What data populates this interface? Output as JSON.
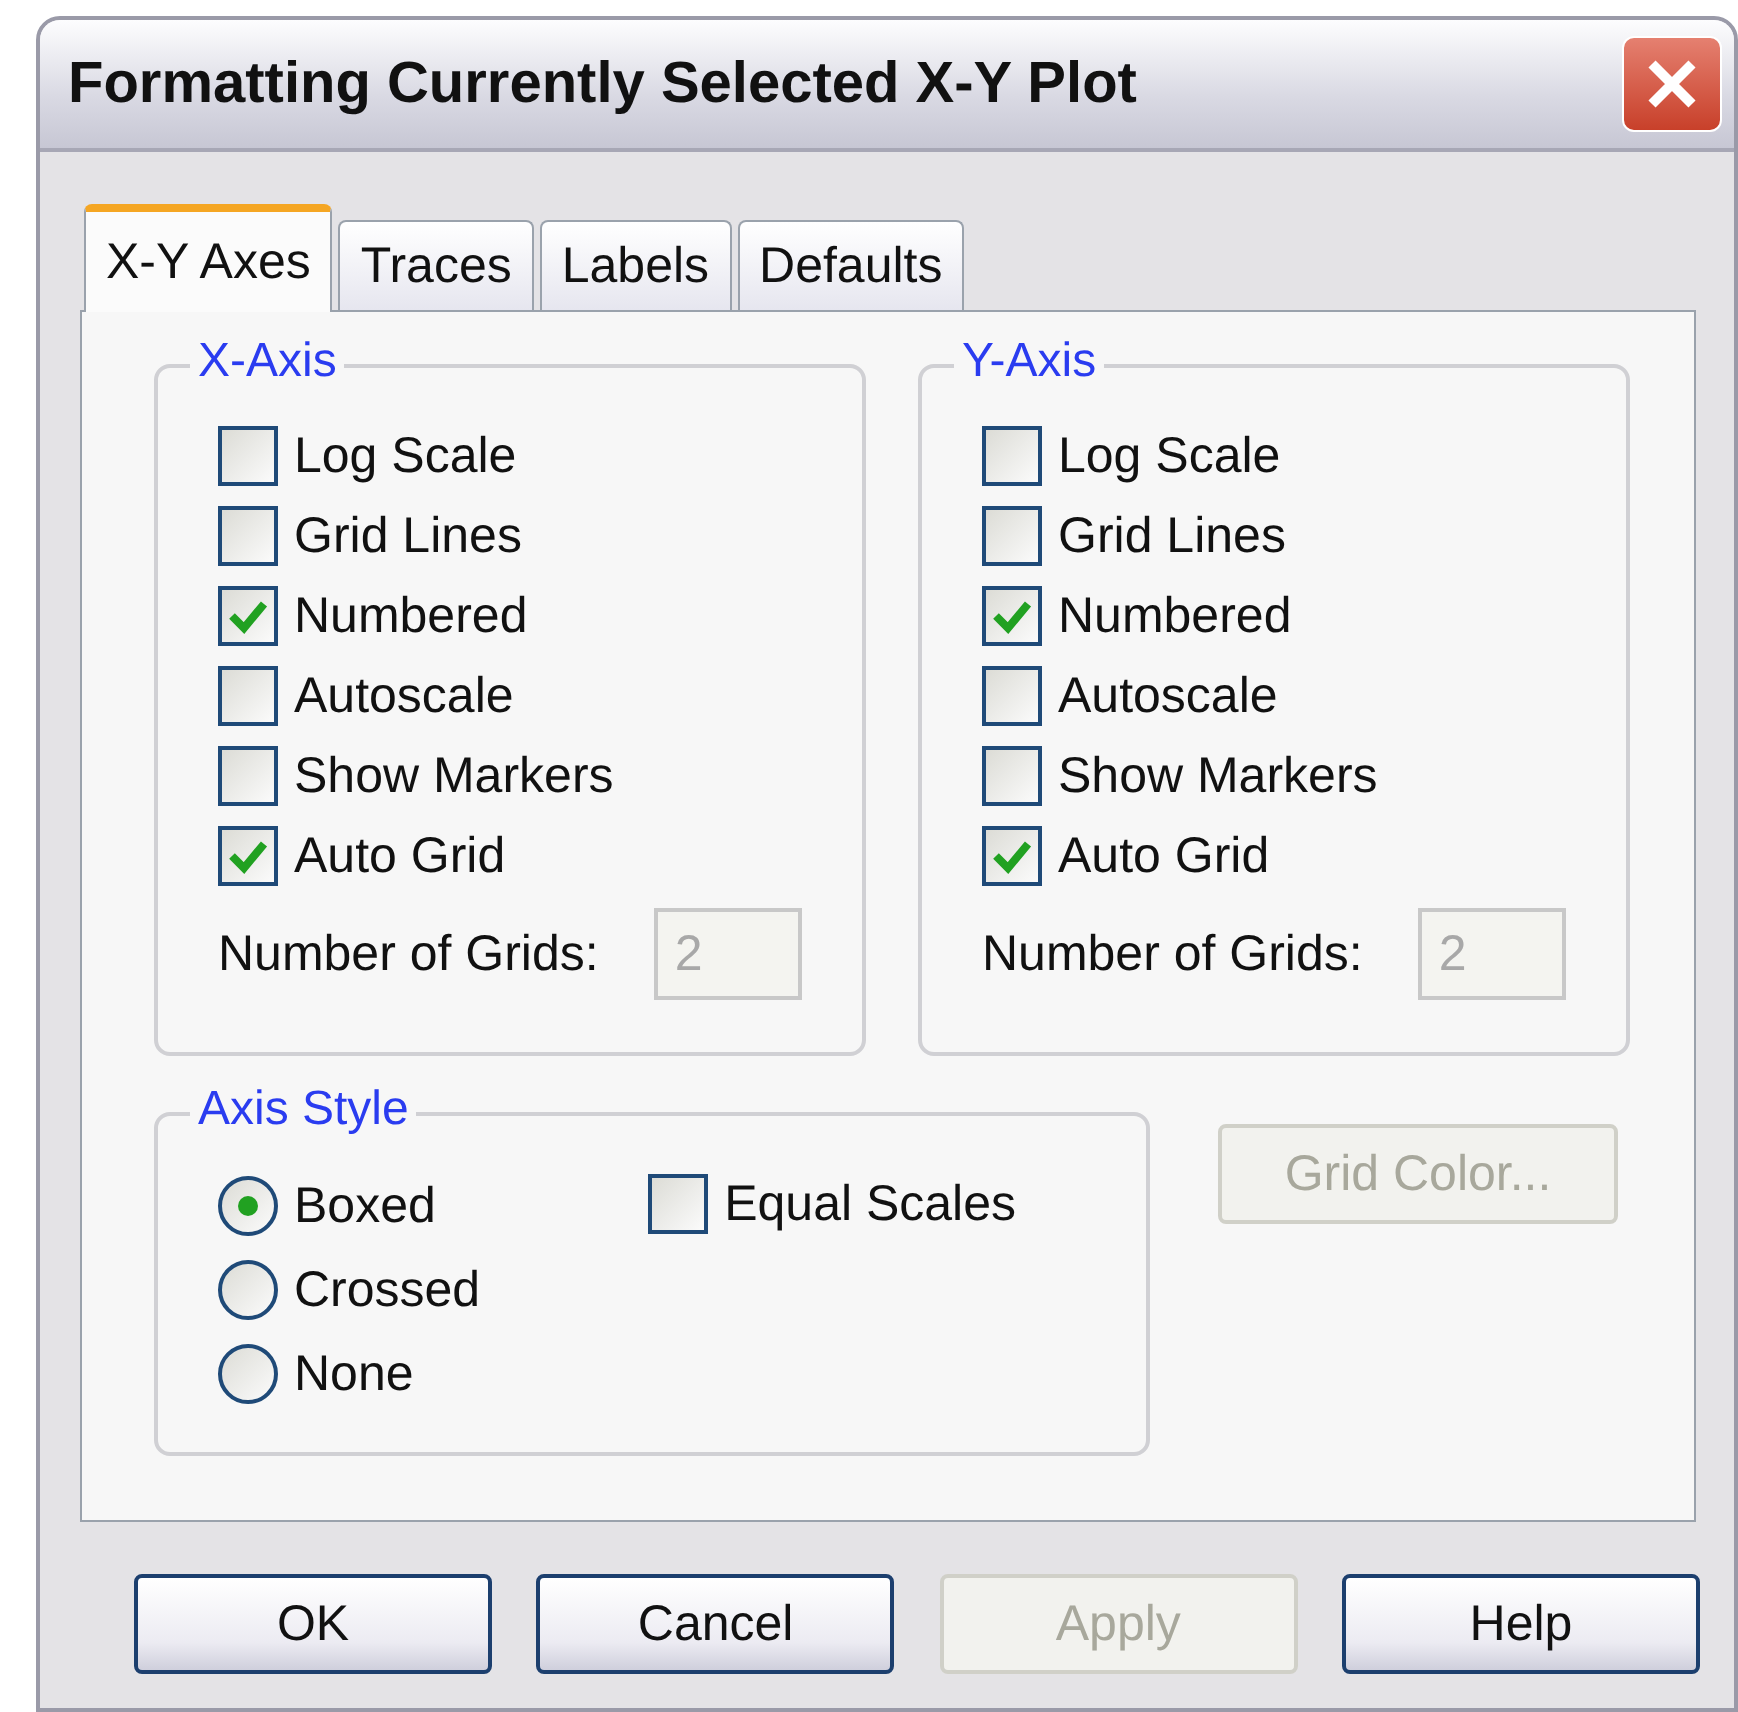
{
  "window": {
    "title": "Formatting Currently Selected X-Y Plot"
  },
  "tabs": [
    {
      "label": "X-Y Axes",
      "selected": true
    },
    {
      "label": "Traces",
      "selected": false
    },
    {
      "label": "Labels",
      "selected": false
    },
    {
      "label": "Defaults",
      "selected": false
    }
  ],
  "axes": [
    {
      "title": "X-Axis",
      "options": [
        {
          "label": "Log Scale",
          "checked": false
        },
        {
          "label": "Grid Lines",
          "checked": false
        },
        {
          "label": "Numbered",
          "checked": true
        },
        {
          "label": "Autoscale",
          "checked": false
        },
        {
          "label": "Show Markers",
          "checked": false
        },
        {
          "label": "Auto Grid",
          "checked": true
        }
      ],
      "grids_label": "Number of Grids:",
      "grids_value": "2",
      "grids_disabled": true
    },
    {
      "title": "Y-Axis",
      "options": [
        {
          "label": "Log Scale",
          "checked": false
        },
        {
          "label": "Grid Lines",
          "checked": false
        },
        {
          "label": "Numbered",
          "checked": true
        },
        {
          "label": "Autoscale",
          "checked": false
        },
        {
          "label": "Show Markers",
          "checked": false
        },
        {
          "label": "Auto Grid",
          "checked": true
        }
      ],
      "grids_label": "Number of Grids:",
      "grids_value": "2",
      "grids_disabled": true
    }
  ],
  "axis_style": {
    "title": "Axis Style",
    "options": [
      {
        "label": "Boxed",
        "selected": true
      },
      {
        "label": "Crossed",
        "selected": false
      },
      {
        "label": "None",
        "selected": false
      }
    ],
    "equal_scales": {
      "label": "Equal Scales",
      "checked": false
    }
  },
  "grid_color_button": {
    "label": "Grid Color...",
    "disabled": true
  },
  "buttons": [
    {
      "label": "OK",
      "disabled": false
    },
    {
      "label": "Cancel",
      "disabled": false
    },
    {
      "label": "Apply",
      "disabled": true
    },
    {
      "label": "Help",
      "disabled": false
    }
  ]
}
